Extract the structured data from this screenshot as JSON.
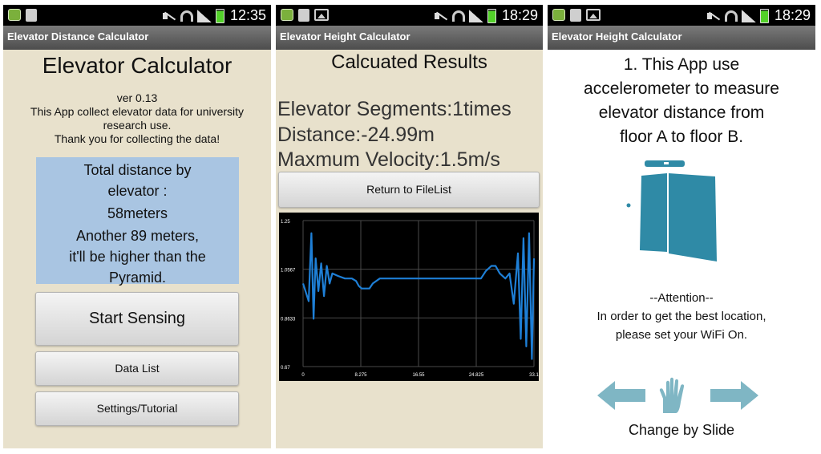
{
  "screens": [
    {
      "status": {
        "time": "12:35"
      },
      "title": "Elevator Distance Calculator",
      "heading": "Elevator Calculator",
      "version": "ver 0.13",
      "desc_line1": "This App collect elevator data for university",
      "desc_line2": "research use.",
      "desc_line3": "Thank you for collecting the data!",
      "info_line1": "Total distance by",
      "info_line2": "elevator :",
      "info_line3": "58meters",
      "info_line4": "Another 89 meters,",
      "info_line5": "it'll be higher than the",
      "info_line6": "Pyramid.",
      "btn_start": "Start Sensing",
      "btn_datalist": "Data List",
      "btn_settings": "Settings/Tutorial"
    },
    {
      "status": {
        "time": "18:29"
      },
      "title": "Elevator Height Calculator",
      "heading": "Calcuated Results",
      "segments": "Elevator Segments:1times",
      "distance": "Distance:-24.99m",
      "velocity": "Maxmum Velocity:1.5m/s",
      "btn_return": "Return to FileList"
    },
    {
      "status": {
        "time": "18:29"
      },
      "title": "Elevator Height Calculator",
      "tut_line1": "1. This App use",
      "tut_line2": "accelerometer to measure",
      "tut_line3": "elevator distance from",
      "tut_line4": "floor A to floor B.",
      "attn_line1": "--Attention--",
      "attn_line2": "In order to get the best location,",
      "attn_line3": "please set your WiFi On.",
      "slide_caption": "Change by Slide"
    }
  ],
  "chart_data": {
    "type": "line",
    "y_ticks": [
      "1.25",
      "1.0567",
      "0.8633",
      "0.67"
    ],
    "x_ticks": [
      "0",
      "8.275",
      "16.55",
      "24.825",
      "33.1"
    ],
    "xlim": [
      0,
      33.1
    ],
    "ylim": [
      0.67,
      1.25
    ],
    "grid": true,
    "series": [
      {
        "color": "#1e7fd6",
        "x": [
          0.0,
          0.8,
          1.2,
          1.5,
          1.8,
          2.2,
          2.6,
          3.0,
          3.4,
          3.8,
          4.2,
          5.0,
          6.0,
          7.0,
          7.6,
          8.0,
          8.4,
          9.0,
          9.5,
          10.0,
          11.0,
          12.0,
          14.0,
          16.0,
          18.0,
          20.0,
          22.0,
          24.0,
          25.5,
          26.2,
          27.0,
          27.6,
          28.2,
          29.0,
          29.6,
          30.2,
          30.8,
          31.2,
          31.6,
          32.0,
          32.4,
          32.8,
          33.1
        ],
        "y": [
          1.0,
          0.93,
          1.2,
          0.86,
          1.1,
          0.97,
          1.08,
          0.95,
          1.07,
          1.0,
          1.04,
          1.03,
          1.02,
          1.02,
          1.01,
          0.99,
          0.98,
          0.98,
          0.98,
          1.0,
          1.02,
          1.02,
          1.02,
          1.02,
          1.02,
          1.02,
          1.02,
          1.02,
          1.02,
          1.05,
          1.07,
          1.07,
          1.04,
          1.02,
          1.04,
          0.92,
          1.12,
          0.78,
          1.18,
          0.75,
          1.2,
          0.7,
          1.1
        ]
      }
    ]
  }
}
